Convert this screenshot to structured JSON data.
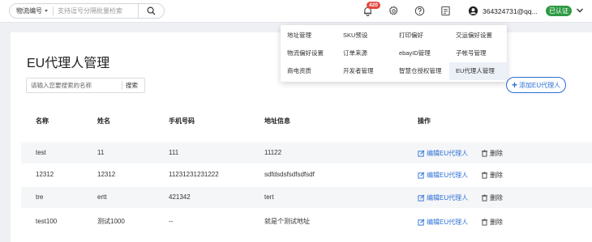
{
  "topbar": {
    "search_select": "物流编号",
    "search_placeholder": "支持逗号分隔批量检索",
    "notification_count": "420",
    "user_name": "364324731@qq...",
    "verified_label": "已认证"
  },
  "page": {
    "title": "EU代理人管理",
    "filter_placeholder": "请输入您要搜索的名称",
    "filter_button": "搜索",
    "add_button": "添加EU代理人"
  },
  "table": {
    "headers": [
      "名称",
      "姓名",
      "手机号码",
      "地址信息",
      "操作"
    ],
    "rows": [
      {
        "name": "test",
        "person": "11",
        "phone": "111",
        "address": "11122"
      },
      {
        "name": "12312",
        "person": "12312",
        "phone": "11231231231222",
        "address": "sdfdsdsfsdfsdfsdf"
      },
      {
        "name": "tre",
        "person": "ertt",
        "phone": "421342",
        "address": "tert"
      },
      {
        "name": "test100",
        "person": "测试1000",
        "phone": "--",
        "address": "就是个测试地址"
      }
    ],
    "edit_label": "编辑EU代理人",
    "delete_label": "删除"
  },
  "menu": {
    "items": [
      [
        "地址管理",
        "SKU预设",
        "打印偏好",
        "交运偏好设置"
      ],
      [
        "物流偏好设置",
        "订单来源",
        "ebayID管理",
        "子帐号管理"
      ],
      [
        "商电资质",
        "开发者管理",
        "智慧仓授权管理",
        "EU代理人管理"
      ]
    ]
  },
  "colors": {
    "accent": "#2b6fd6",
    "badge": "#e5483f",
    "verified": "#2f9a44"
  }
}
